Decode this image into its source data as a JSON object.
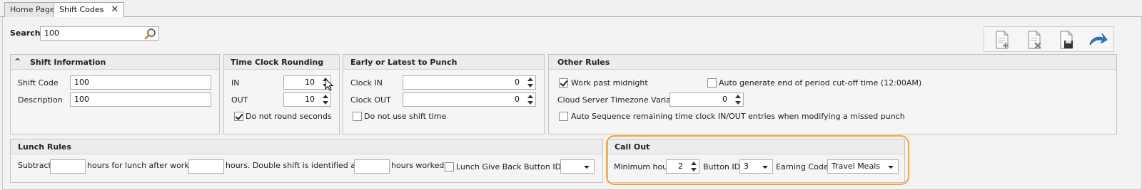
{
  "tabs": [
    {
      "label": "Home Page"
    },
    {
      "label": "Shift Codes",
      "close": "✕"
    }
  ],
  "search": {
    "label": "Search",
    "value": "100"
  },
  "shift_info": {
    "title": "Shift Information",
    "collapse_glyph": "^",
    "shift_code_label": "Shift Code",
    "shift_code_value": "100",
    "description_label": "Description",
    "description_value": "100"
  },
  "rounding": {
    "title": "Time Clock Rounding",
    "in_label": "IN",
    "in_value": "10",
    "out_label": "OUT",
    "out_value": "10",
    "no_round_seconds_label": "Do not round seconds",
    "no_round_seconds_checked": true
  },
  "early_latest": {
    "title": "Early or Latest to Punch",
    "clock_in_label": "Clock IN",
    "clock_in_value": "0",
    "clock_out_label": "Clock OUT",
    "clock_out_value": "0",
    "no_shift_time_label": "Do not use shift time",
    "no_shift_time_checked": false
  },
  "other_rules": {
    "title": "Other Rules",
    "work_past_midnight_label": "Work past midnight",
    "work_past_midnight_checked": true,
    "auto_generate_label": "Auto generate end of period cut-off time (12:00AM)",
    "auto_generate_checked": false,
    "timezone_label": "Cloud Server Timezone Variance",
    "timezone_value": "0",
    "auto_sequence_label": "Auto Sequence remaining time clock IN/OUT entries when modifying a missed punch",
    "auto_sequence_checked": false
  },
  "lunch_rules": {
    "title": "Lunch Rules",
    "subtract_label": "Subtract",
    "subtract_value": "",
    "hours_after_label": "hours for lunch after working",
    "working_value": "",
    "double_shift_label": "hours.  Double shift is identified after",
    "double_value": "",
    "worked_label": "hours worked.",
    "give_back_label": "Lunch Give Back",
    "give_back_checked": false,
    "button_id_label": "Button ID",
    "button_id_value": ""
  },
  "call_out": {
    "title": "Call Out",
    "min_hours_label": "Minimum hours",
    "min_hours_value": "2",
    "button_id_label": "Button ID",
    "button_id_value": "3",
    "earning_code_label": "Earning Code",
    "earning_code_value": "Travel Meals"
  },
  "toolbar": {
    "new_icon": "new-document-icon",
    "delete_icon": "delete-document-icon",
    "save_icon": "save-icon",
    "undo_icon": "undo-icon"
  },
  "colors": {
    "highlight": "#f0a830",
    "accent_blue": "#2f7fd0"
  }
}
